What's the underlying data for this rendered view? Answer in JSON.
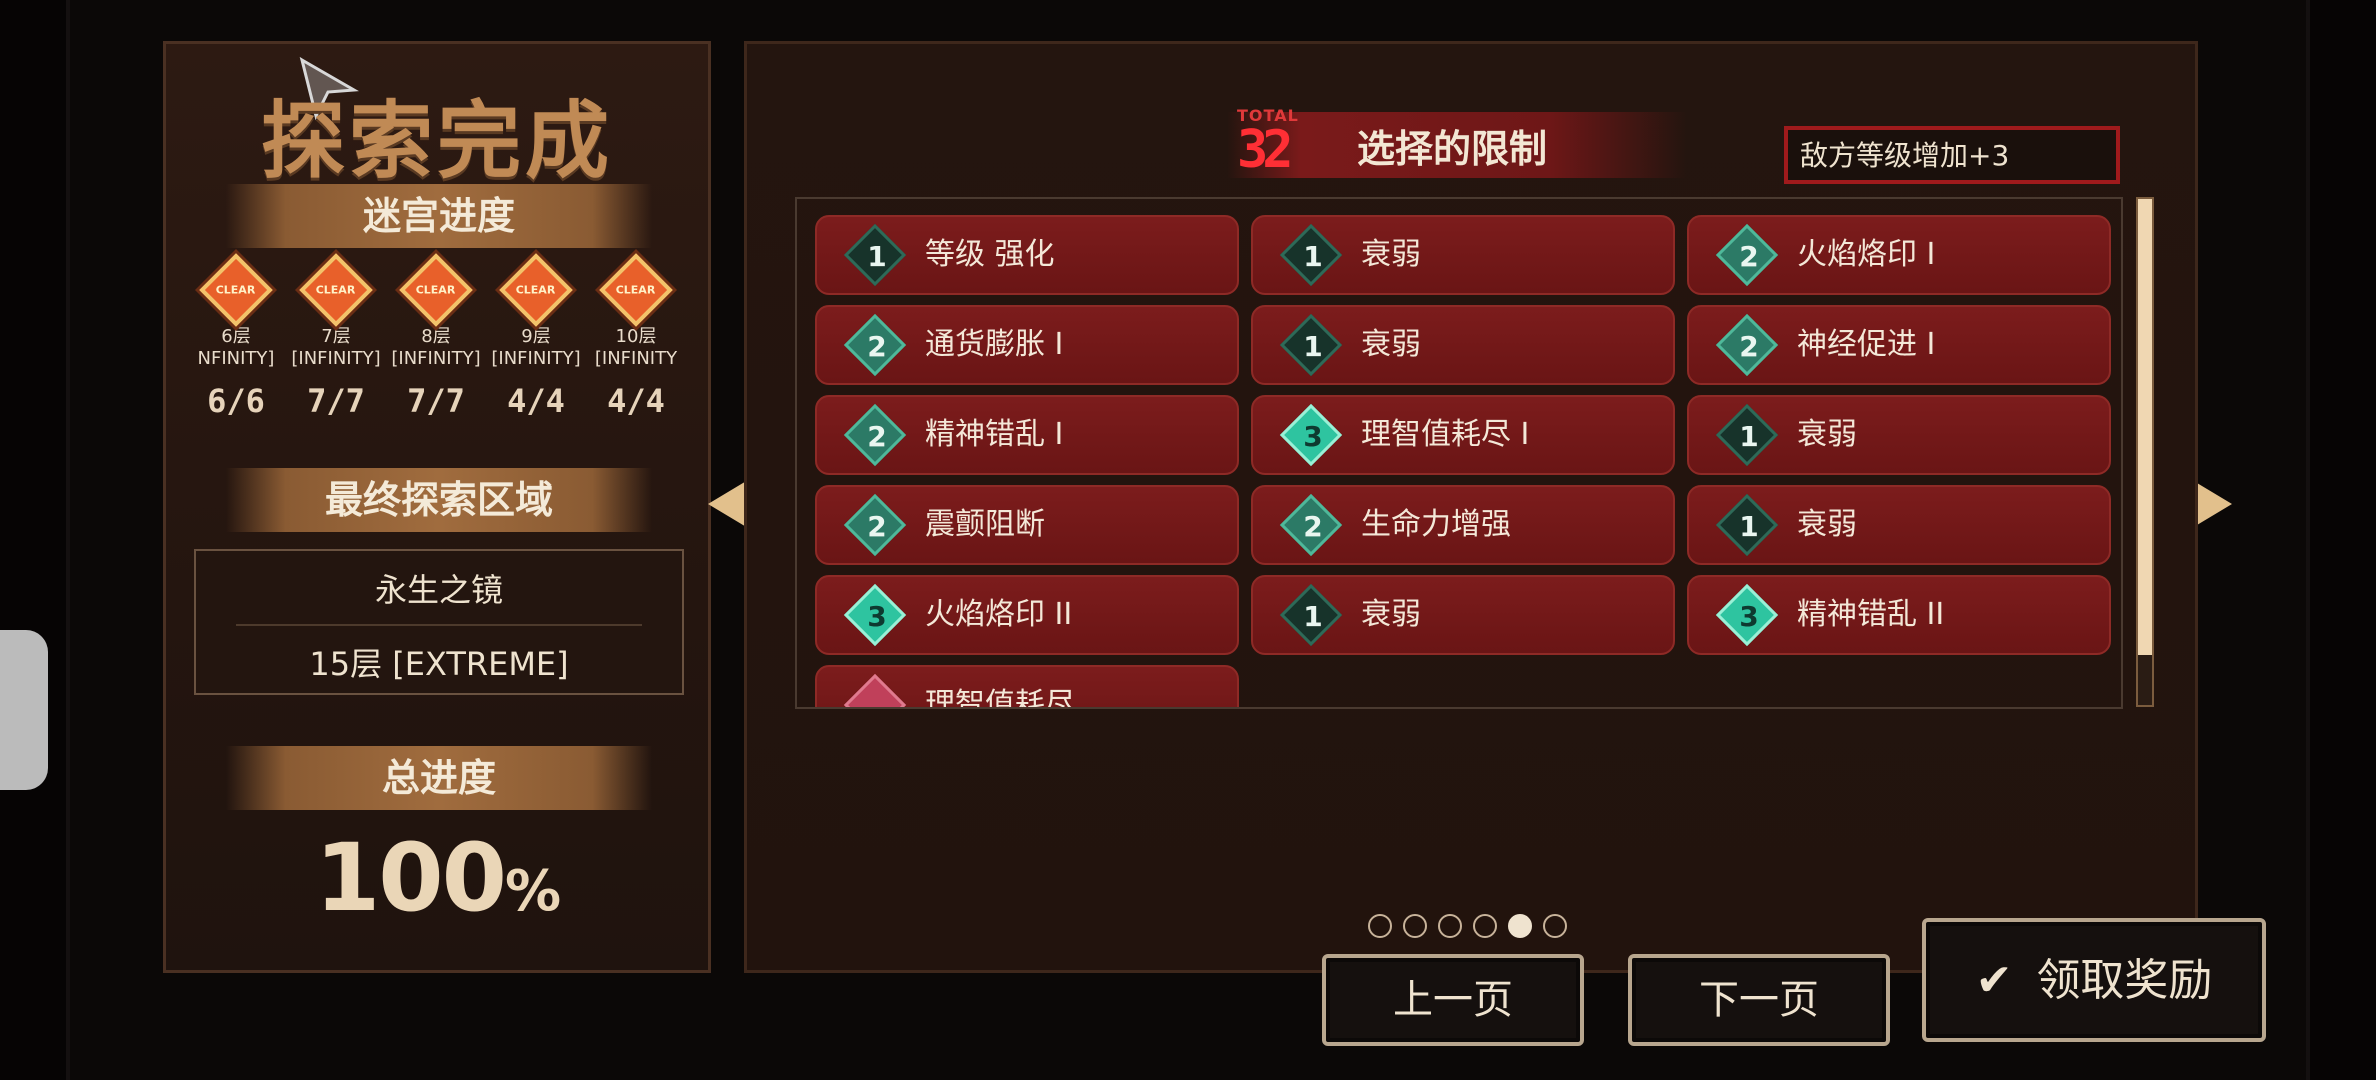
{
  "summary": {
    "title": "探索完成",
    "maze_progress_label": "迷宫进度",
    "floors": [
      {
        "name": "6层",
        "mode": "NFINITY]",
        "count": "6/6"
      },
      {
        "name": "7层",
        "mode": "[INFINITY]",
        "count": "7/7"
      },
      {
        "name": "8层",
        "mode": "[INFINITY]",
        "count": "7/7"
      },
      {
        "name": "9层",
        "mode": "[INFINITY]",
        "count": "4/4"
      },
      {
        "name": "10层",
        "mode": "[INFINITY",
        "count": "4/4"
      }
    ],
    "final_area_label": "最终探索区域",
    "final_area_name": "永生之镜",
    "final_area_floor": "15层 [EXTREME]",
    "total_progress_label": "总进度",
    "total_progress_value": "100",
    "total_progress_unit": "%"
  },
  "restrictions": {
    "total_label": "TOTAL",
    "total_number": "32",
    "title": "选择的限制",
    "enemy_level_note": "敌方等级增加+3",
    "items": [
      {
        "level": "1",
        "label": "等级 强化"
      },
      {
        "level": "1",
        "label": "衰弱"
      },
      {
        "level": "2",
        "label": "火焰烙印 I"
      },
      {
        "level": "2",
        "label": "通货膨胀 I"
      },
      {
        "level": "1",
        "label": "衰弱"
      },
      {
        "level": "2",
        "label": "神经促进 I"
      },
      {
        "level": "2",
        "label": "精神错乱 I"
      },
      {
        "level": "3",
        "label": "理智值耗尽 I"
      },
      {
        "level": "1",
        "label": "衰弱"
      },
      {
        "level": "2",
        "label": "震颤阻断"
      },
      {
        "level": "2",
        "label": "生命力增强"
      },
      {
        "level": "1",
        "label": "衰弱"
      },
      {
        "level": "3",
        "label": "火焰烙印 II"
      },
      {
        "level": "1",
        "label": "衰弱"
      },
      {
        "level": "3",
        "label": "精神错乱 II"
      }
    ],
    "partial_item_label": "理智值耗尽"
  },
  "pagination": {
    "total_pages": 6,
    "active_page": 5
  },
  "buttons": {
    "prev": "上一页",
    "next": "下一页",
    "claim": "领取奖励"
  },
  "colors": {
    "accent_red": "#a01a1c",
    "card_red": "#7c1c1c",
    "gold": "#e2c08c",
    "teal": "#2ec4a0"
  }
}
